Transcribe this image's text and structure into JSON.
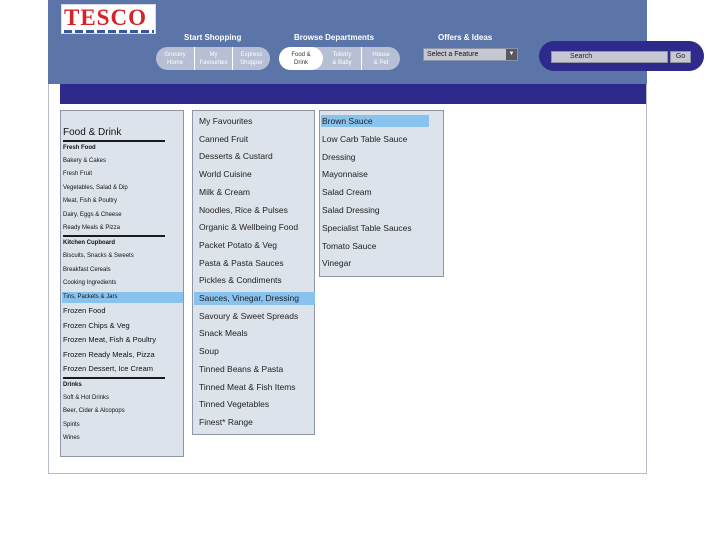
{
  "logo": {
    "text": "TESCO"
  },
  "header": {
    "start_shopping": "Start Shopping",
    "browse_departments": "Browse Departments",
    "offers_ideas": "Offers & Ideas"
  },
  "start_tabs": [
    "Grocery\nHome",
    "My\nFavourites",
    "Express\nShopper"
  ],
  "dept_tabs": [
    "Food &\nDrink",
    "Toiletry\n& Baby",
    "House\n& Pet"
  ],
  "feature_select": {
    "value": "Select a Feature",
    "arrow": "▼"
  },
  "search": {
    "label": "Search",
    "go": "Go"
  },
  "category": {
    "title": "Food & Drink",
    "sections": [
      {
        "heading": "Fresh Food",
        "items": [
          "Bakery & Cakes",
          "Fresh Fruit",
          "Vegetables, Salad & Dip",
          "Meat, Fish & Poultry",
          "Dairy, Eggs & Cheese",
          "Ready Meals & Pizza"
        ]
      },
      {
        "heading": "Kitchen Cupboard",
        "items": [
          "Biscuits, Snacks & Sweets",
          "Breakfast Cereals",
          "Cooking Ingredients",
          "Tins, Packets & Jars",
          "Frozen Food",
          "Frozen Chips & Veg",
          "Frozen Meat, Fish & Poultry",
          "Frozen Ready Meals, Pizza",
          "Frozen Dessert, Ice Cream"
        ]
      },
      {
        "heading": "Drinks",
        "items": [
          "Soft & Hot Drinks",
          "Beer, Cider & Alcopops",
          "Spirits",
          "Wines"
        ]
      }
    ],
    "selected": "Tins, Packets & Jars"
  },
  "subcategories": {
    "items": [
      "My Favourites",
      "Canned Fruit",
      "Desserts & Custard",
      "World Cuisine",
      "Milk & Cream",
      "Noodles, Rice & Pulses",
      "Organic & Wellbeing Food",
      "Packet Potato & Veg",
      "Pasta & Pasta Sauces",
      "Pickles & Condiments",
      "Sauces, Vinegar, Dressing",
      "Savoury & Sweet Spreads",
      "Snack Meals",
      "Soup",
      "Tinned Beans & Pasta",
      "Tinned Meat & Fish Items",
      "Tinned Vegetables",
      "Finest* Range"
    ],
    "selected": "Sauces, Vinegar, Dressing"
  },
  "products": {
    "items": [
      "Brown Sauce",
      "Low Carb Table Sauce",
      "Dressing",
      "Mayonnaise",
      "Salad Cream",
      "Salad Dressing",
      "Specialist Table Sauces",
      "Tomato Sauce",
      "Vinegar"
    ],
    "selected": "Brown Sauce"
  },
  "colors": {
    "header_bg": "#5b75a9",
    "nav_bar": "#2d2a8c",
    "panel_bg": "#dde3ea",
    "selected_bg": "#88c3f0",
    "logo_red": "#d6232a"
  }
}
